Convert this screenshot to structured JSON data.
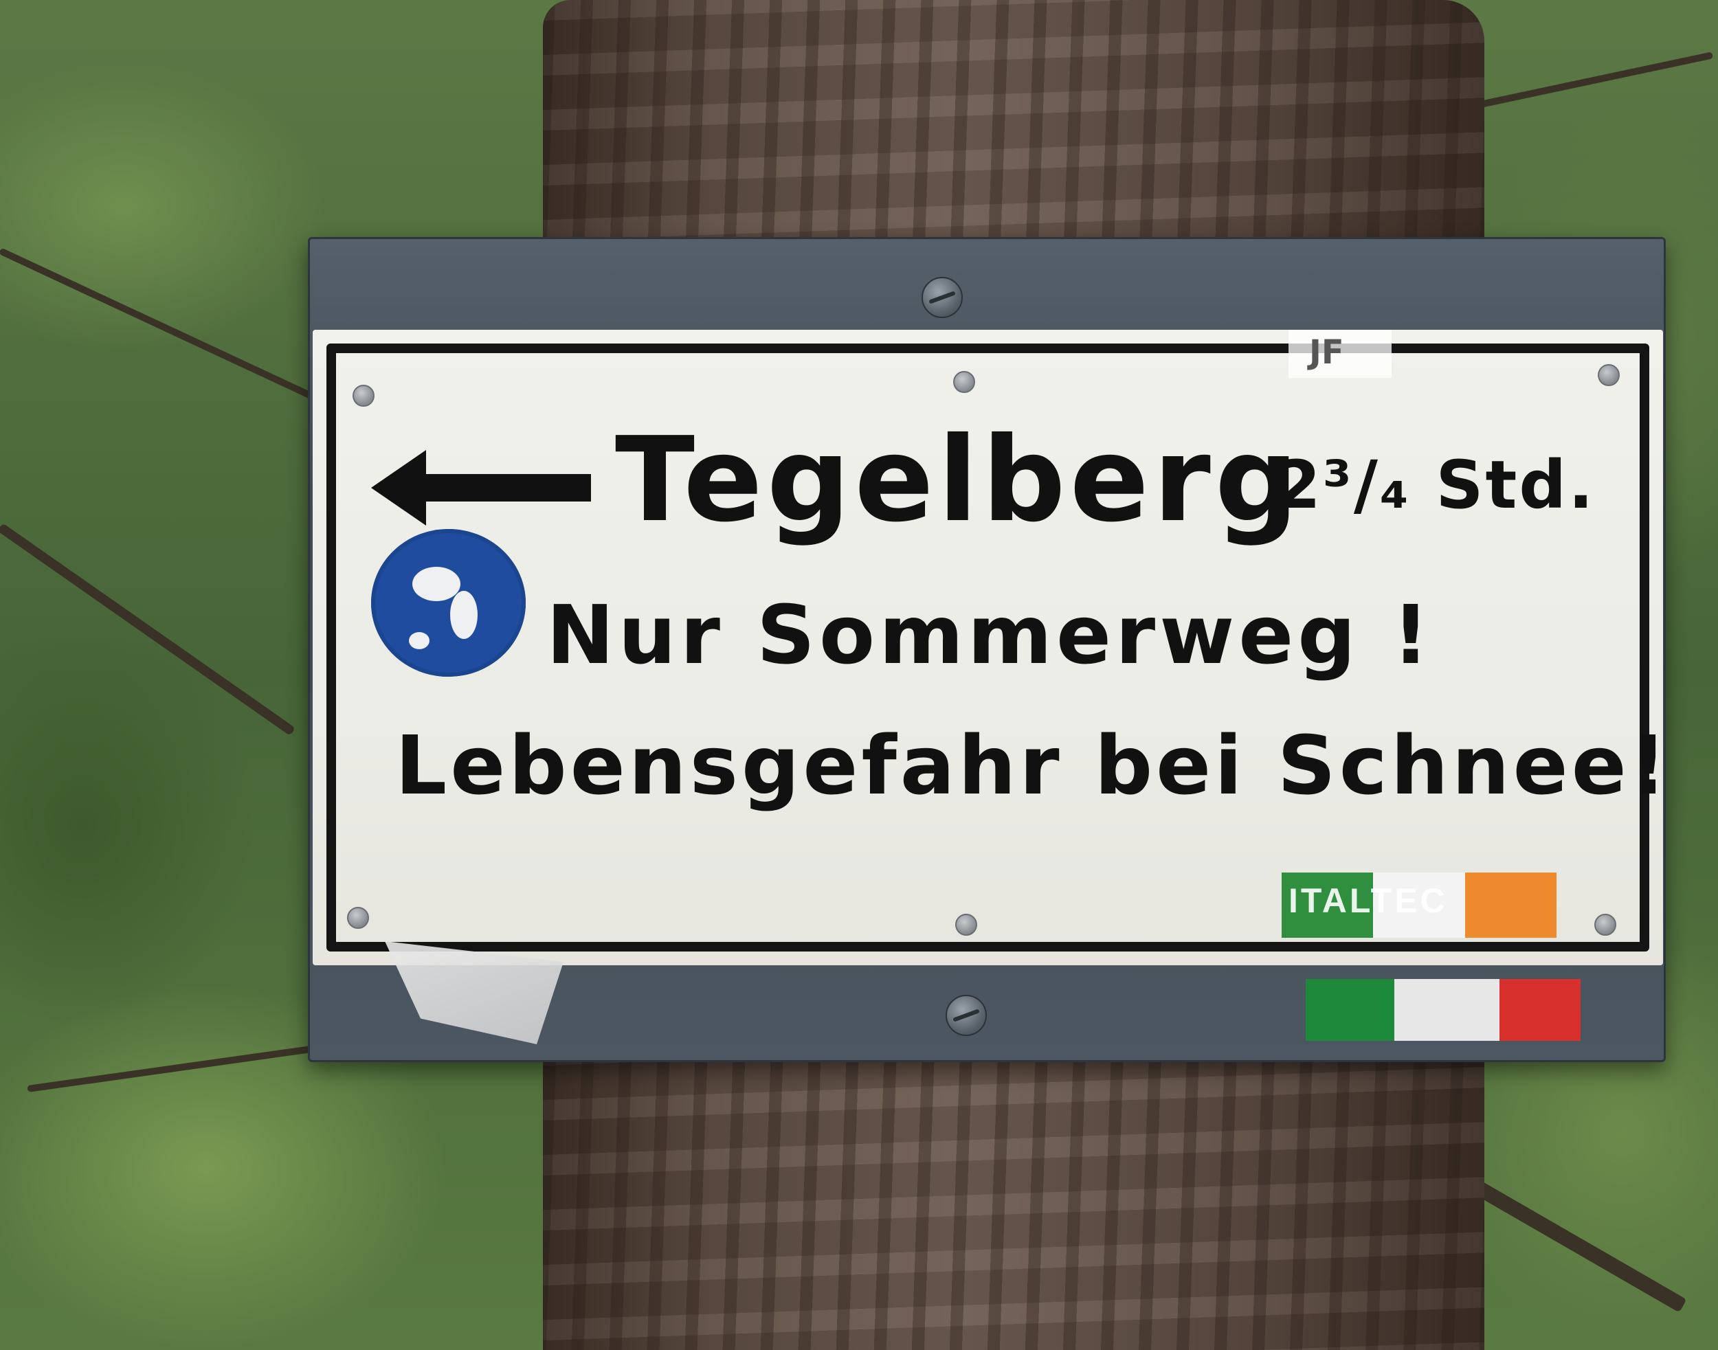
{
  "sign": {
    "destination": "Tegelberg",
    "duration": "2³/₄ Std.",
    "line2": "Nur Sommerweg !",
    "line3": "Lebensgefahr bei Schnee!",
    "corner_mark": "JF",
    "sticker_text": "ITALTEC"
  },
  "colors": {
    "sign_face": "#ececE6",
    "lettering": "#111111",
    "trail_marker": "#1f4c9e",
    "plate": "#4c5761"
  },
  "icons": [
    "left-arrow-icon",
    "blue-trail-marker-icon",
    "italian-flag-sticker"
  ]
}
